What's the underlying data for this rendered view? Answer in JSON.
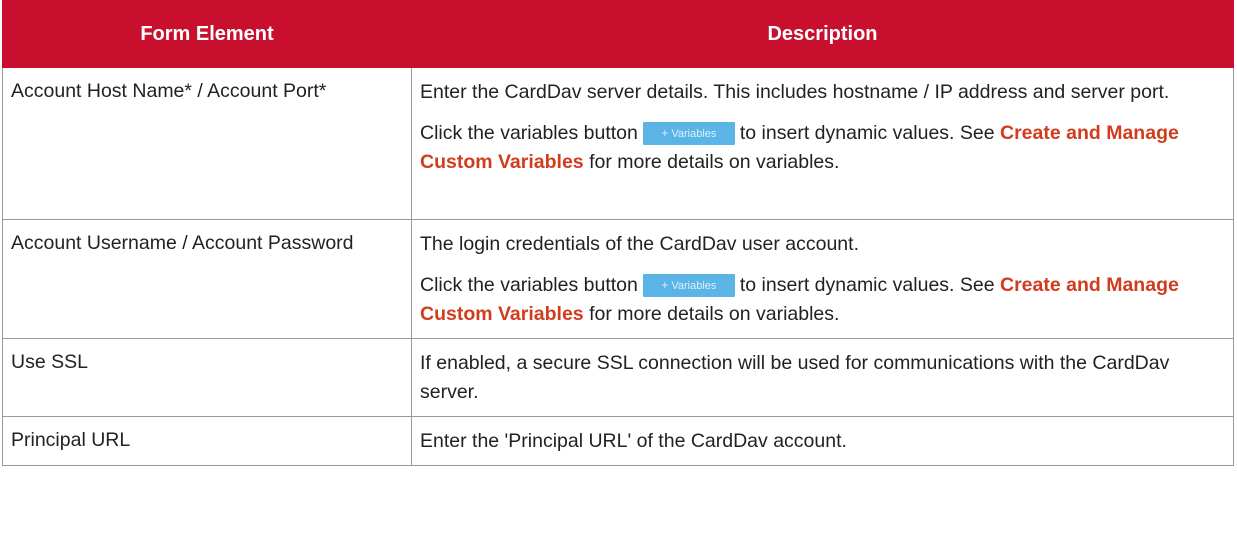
{
  "table": {
    "headers": [
      "Form Element",
      "Description"
    ],
    "rows": [
      {
        "element": "Account Host Name* / Account Port*",
        "p1": "Enter the CardDav server details. This includes hostname / IP address and server port.",
        "p2_before": "Click the variables button",
        "button": "Variables",
        "p2_mid": "to insert dynamic values. See",
        "link": "Create and Manage Custom Variables",
        "p2_after": "for more details on variables."
      },
      {
        "element": "Account Username / Account Password",
        "p1": "The login credentials of the CardDav user account.",
        "p2_before": "Click the variables button",
        "button": "Variables",
        "p2_mid": "to insert dynamic values. See",
        "link": "Create and Manage Custom Variables",
        "p2_after": "for more details on variables."
      },
      {
        "element": "Use SSL",
        "p1": "If enabled, a secure SSL connection will be used for communications with the CardDav server."
      },
      {
        "element": "Principal URL",
        "p1": "Enter the 'Principal URL' of the CardDav account."
      }
    ]
  },
  "colors": {
    "header_bg": "#c8102e",
    "link": "#d23c1e",
    "button_bg": "#5ab4e6"
  }
}
